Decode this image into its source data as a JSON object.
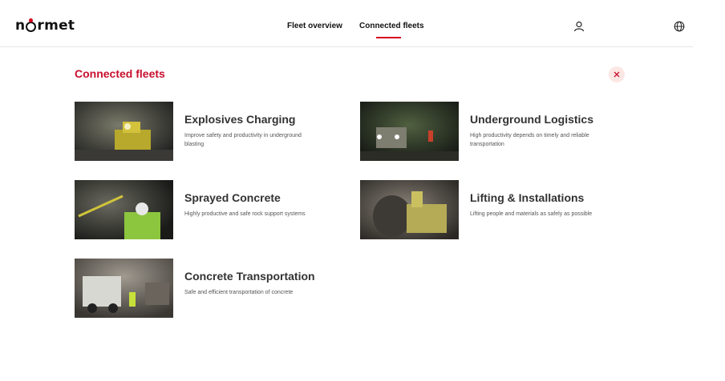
{
  "brand": {
    "logo_text_pre": "n",
    "logo_text_post": "rmet"
  },
  "nav": {
    "fleet_overview": "Fleet overview",
    "connected_fleets": "Connected fleets"
  },
  "panel": {
    "title": "Connected fleets"
  },
  "colors": {
    "accent": "#c8102e",
    "close_bg": "#fbe7e4"
  },
  "fleets": [
    {
      "title": "Explosives Charging",
      "description": "Improve safety and productivity in underground blasting"
    },
    {
      "title": "Underground Logistics",
      "description": "High productivity depends on timely and reliable transportation"
    },
    {
      "title": "Sprayed Concrete",
      "description": "Highly productive and safe rock support systems"
    },
    {
      "title": "Lifting & Installations",
      "description": "Lifting people and materials as safely as possible"
    },
    {
      "title": "Concrete Transportation",
      "description": "Safe and efficient transportation of concrete"
    }
  ]
}
